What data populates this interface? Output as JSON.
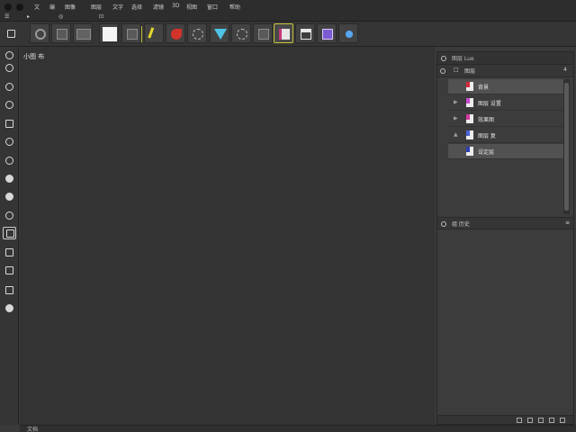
{
  "menu": {
    "top_items": [
      "文",
      "编",
      "图像",
      "图层",
      "文字",
      "选择",
      "滤镜",
      "3D",
      "视图",
      "窗口",
      "帮助"
    ],
    "bottom_items": [
      "☰",
      "▸",
      "◎",
      "⊡"
    ]
  },
  "canvas": {
    "title": "小图 布"
  },
  "status": {
    "text": "文档"
  },
  "panel": {
    "title": "图层 Lue",
    "tab_count": "4",
    "tab_label": "图层",
    "layers": [
      {
        "expander": "",
        "name": "背景",
        "highlighted": true
      },
      {
        "expander": "▶",
        "name": "图层 设置",
        "highlighted": false
      },
      {
        "expander": "▶",
        "name": "效果图",
        "highlighted": false
      },
      {
        "expander": "▲",
        "name": "图层 复",
        "highlighted": false
      },
      {
        "expander": "",
        "name": "设定层",
        "highlighted": true
      }
    ],
    "panel2_title": "组 历史"
  },
  "icons": {
    "toolbar": [
      "gear-icon",
      "transform-icon",
      "image-icon",
      "color-swatch-icon",
      "crop-icon",
      "pen-icon",
      "magnet-icon",
      "lasso-icon",
      "gradient-icon",
      "scope-icon",
      "mask-icon",
      "book-icon",
      "table-icon",
      "plugin-icon",
      "star-icon"
    ]
  }
}
